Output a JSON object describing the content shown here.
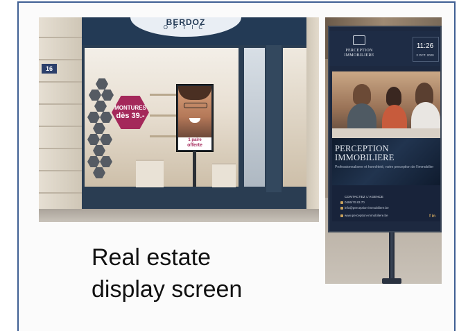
{
  "left_photo": {
    "shop_name": "BERDOZ",
    "shop_subtitle": "OPTIC",
    "house_number": "16",
    "promo_line1": "MONTURES",
    "promo_line2": "dès 39.-",
    "screen_caption_line1": "1 paire",
    "screen_caption_line2": "offerte"
  },
  "caption": {
    "line1": "Real estate",
    "line2": "display screen"
  },
  "right_photo": {
    "brand": "PERCEPTION IMMOBILIERE",
    "clock_time": "11:26",
    "clock_date": "2 OCT. 2020",
    "hero_title_line1": "PERCEPTION",
    "hero_title_line2": "IMMOBILIERE",
    "hero_subtitle": "Professionnalisme et honnêteté, notre perception de l'immobilier",
    "contact_heading": "CONTACTEZ L'AGENCE",
    "contact_phone": "0486/70.83.70",
    "contact_email": "info@perception-immobiliere.be",
    "contact_web": "www.perception-immobiliere.be",
    "social": "f  in"
  }
}
